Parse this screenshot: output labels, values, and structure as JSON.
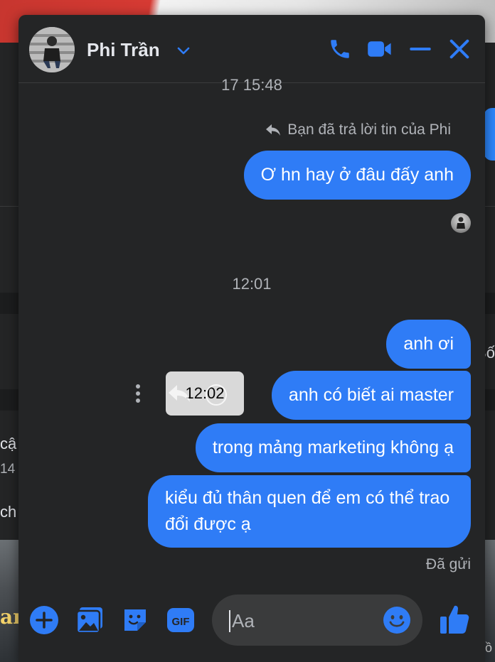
{
  "background": {
    "left_fragments": [
      "cậ",
      "14",
      "ch"
    ],
    "right_fragment": "Bố",
    "bottom_fragment": "an",
    "bottom_right_fragment": "ồ"
  },
  "chat": {
    "contact_name": "Phi Trần",
    "partial_timestamp": "17 15:48",
    "reply_note": "Bạn đã trả lời tin của Phi",
    "messages": [
      {
        "text": "Ơ hn hay ở đâu đấy anh"
      },
      {
        "text": "anh ơi"
      },
      {
        "text": "anh có biết ai master"
      },
      {
        "text": "trong mảng marketing không ạ"
      },
      {
        "text": "kiểu đủ thân quen để em có thể trao đổi được ạ"
      }
    ],
    "timestamp_divider": "12:01",
    "hover_time": "12:02",
    "status": "Đã gửi",
    "composer": {
      "placeholder": "Aa",
      "gif_label": "GIF"
    }
  },
  "colors": {
    "accent": "#2f7cf6",
    "window_bg": "#242526",
    "input_bg": "#3a3b3c",
    "secondary_text": "#b0b3b8",
    "primary_text": "#e4e6eb"
  },
  "icons": [
    "chevron-down-icon",
    "phone-icon",
    "video-icon",
    "minimize-icon",
    "close-icon",
    "reply-icon",
    "more-vertical-icon",
    "react-icon",
    "plus-icon",
    "image-icon",
    "sticker-icon",
    "gif-icon",
    "emoji-icon",
    "thumbs-up-icon"
  ]
}
